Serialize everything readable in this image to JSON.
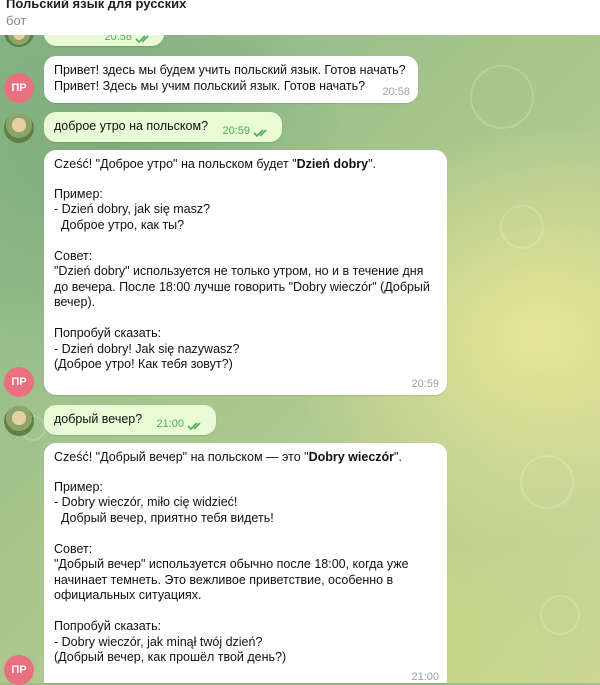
{
  "header": {
    "title": "Польский язык для русских",
    "subtitle": "бот"
  },
  "messages": [
    {
      "id": "m0",
      "time": "20:58"
    },
    {
      "id": "m1",
      "from": "bot",
      "avatar": "ПР",
      "lines": [
        "Привет! здесь мы будем учить польский язык. Готов начать?",
        "Привет! Здесь мы учим польский язык. Готов начать?"
      ],
      "time": "20:58"
    },
    {
      "id": "m2",
      "from": "user",
      "text": "доброе утро на польском?",
      "time": "20:59"
    },
    {
      "id": "m3",
      "from": "bot",
      "avatar": "ПР",
      "intro_pre": "Cześć! \"Доброе утро\" на польском будет \"",
      "intro_bold": "Dzień dobry",
      "intro_post": "\".",
      "body": "Пример:\n- Dzień dobry, jak się masz?\n  Доброе утро, как ты?\n\nСовет:\n\"Dzień dobry\" используется не только утром, но и в течение дня до вечера. После 18:00 лучше говорить \"Dobry wieczór\" (Добрый вечер).\n\nПопробуй сказать:\n- Dzień dobry! Jak się nazywasz?\n(Доброе утро! Как тебя зовут?)",
      "time": "20:59"
    },
    {
      "id": "m4",
      "from": "user",
      "text": "добрый вечер?",
      "time": "21:00"
    },
    {
      "id": "m5",
      "from": "bot",
      "avatar": "ПР",
      "intro_pre": "Cześć! \"Добрый вечер\" на польском — это \"",
      "intro_bold": "Dobry wieczór",
      "intro_post": "\".",
      "body": "Пример:\n- Dobry wieczór, miło cię widzieć!\n  Добрый вечер, приятно тебя видеть!\n\nСовет:\n\"Добрый вечер\" используется обычно после 18:00, когда уже начинает темнеть. Это вежливое приветствие, особенно в официальных ситуациях.\n\nПопробуй сказать:\n- Dobry wieczór, jak minął twój dzień?\n(Добрый вечер, как прошёл твой день?)",
      "time": "21:00"
    }
  ],
  "colors": {
    "bot_avatar": "#ea6f7f",
    "outgoing_bubble": "#e9fbd6",
    "incoming_bubble": "#ffffff",
    "read_check": "#4fae4e"
  }
}
